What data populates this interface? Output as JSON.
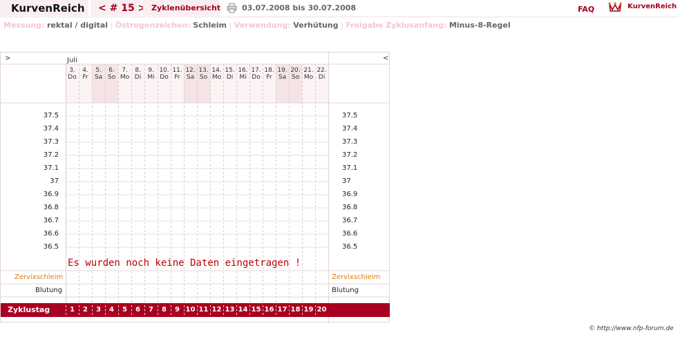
{
  "header": {
    "logo": "KurvenReich",
    "cycle_nav": "< # 15 >",
    "overview_link": "Zyklenübersicht",
    "date_range": "03.07.2008 bis 30.07.2008",
    "faq": "FAQ",
    "brand": "KurvenReich"
  },
  "info": {
    "messung_label": "Messung:",
    "messung_value": "rektal / digital",
    "oestrogen_label": "Östrogenzeichen:",
    "oestrogen_value": "Schleim",
    "verwendung_label": "Verwendung:",
    "verwendung_value": "Verhütung",
    "freigabe_label": "Freigabe Zyklusanfang:",
    "freigabe_value": "Minus-8-Regel",
    "separator": "|"
  },
  "chart": {
    "prev_arrow": ">",
    "next_arrow": "<",
    "month": "Juli",
    "days": [
      {
        "num": "3.",
        "wd": "Do",
        "weekend": false
      },
      {
        "num": "4.",
        "wd": "Fr",
        "weekend": false
      },
      {
        "num": "5.",
        "wd": "Sa",
        "weekend": true
      },
      {
        "num": "6.",
        "wd": "So",
        "weekend": true
      },
      {
        "num": "7.",
        "wd": "Mo",
        "weekend": false
      },
      {
        "num": "8.",
        "wd": "Di",
        "weekend": false
      },
      {
        "num": "9.",
        "wd": "Mi",
        "weekend": false
      },
      {
        "num": "10.",
        "wd": "Do",
        "weekend": false
      },
      {
        "num": "11.",
        "wd": "Fr",
        "weekend": false
      },
      {
        "num": "12.",
        "wd": "Sa",
        "weekend": true
      },
      {
        "num": "13.",
        "wd": "So",
        "weekend": true
      },
      {
        "num": "14.",
        "wd": "Mo",
        "weekend": false
      },
      {
        "num": "15.",
        "wd": "Di",
        "weekend": false
      },
      {
        "num": "16.",
        "wd": "Mi",
        "weekend": false
      },
      {
        "num": "17.",
        "wd": "Do",
        "weekend": false
      },
      {
        "num": "18.",
        "wd": "Fr",
        "weekend": false
      },
      {
        "num": "19.",
        "wd": "Sa",
        "weekend": true
      },
      {
        "num": "20.",
        "wd": "So",
        "weekend": true
      },
      {
        "num": "21.",
        "wd": "Mo",
        "weekend": false
      },
      {
        "num": "22.",
        "wd": "Di",
        "weekend": false
      }
    ],
    "temperatures": [
      "37.5",
      "37.4",
      "37.3",
      "37.2",
      "37.1",
      "37",
      "36.9",
      "36.8",
      "36.7",
      "36.6",
      "36.5"
    ],
    "no_data_message": "Es wurden noch keine Daten eingetragen !",
    "row_zervix": "Zervixschleim",
    "row_blutung": "Blutung",
    "row_zyklustag": "Zyklustag",
    "zyklustage": [
      "1",
      "2",
      "3",
      "4",
      "5",
      "6",
      "7",
      "8",
      "9",
      "10",
      "11",
      "12",
      "13",
      "14",
      "15",
      "16",
      "17",
      "18",
      "19",
      "20"
    ]
  },
  "footer": {
    "copyright": "© http://www.nfp-forum.de"
  },
  "colors": {
    "brand": "#a0001e",
    "weekend_bg": "#f4e4e6",
    "zyklus_bar": "#a80020",
    "zervix_text": "#e07a10"
  }
}
